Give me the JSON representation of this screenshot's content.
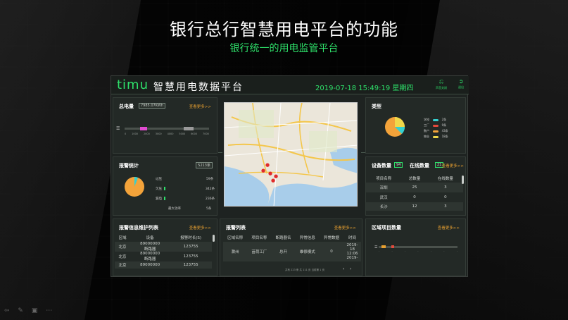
{
  "slide": {
    "headline": "银行总行智慧用电平台的功能",
    "subline": "银行统一的用电监管平台"
  },
  "topbar": {
    "logo": "timu",
    "title": "智慧用电数据平台",
    "datetime": "2019-07-18 15:49:19 星期四",
    "icon1_label": "声音关闭",
    "icon2_label": "退出"
  },
  "total_power": {
    "title": "总电量",
    "value": "7985.07KWh",
    "more": "查看更多>>",
    "axis_labels": [
      "0",
      "1000",
      "2000",
      "3000",
      "4000",
      "5000",
      "6000",
      "7000"
    ]
  },
  "alarm_stats": {
    "title": "报警统计",
    "count": "5213条",
    "items": [
      {
        "label": "过压",
        "value": "59条"
      },
      {
        "label": "欠压",
        "value": "342条"
      },
      {
        "label": "漏电",
        "value": "236条"
      },
      {
        "label": "最大功率",
        "value": "5条"
      }
    ]
  },
  "types": {
    "title": "类型",
    "legend": [
      {
        "label": "学校",
        "value": "2条",
        "color": "#35d0d0"
      },
      {
        "label": "工厂",
        "value": "9条",
        "color": "#e34a3c"
      },
      {
        "label": "数户",
        "value": "43条",
        "color": "#f3a33a"
      },
      {
        "label": "物业",
        "value": "18条",
        "color": "#f0d84a"
      }
    ]
  },
  "devices": {
    "title": "设备数量",
    "count": "94",
    "online_title": "在线数量",
    "online_count": "21",
    "more": "查看更多>>",
    "headers": [
      "项目名称",
      "总数量",
      "在线数量"
    ],
    "rows": [
      [
        "深圳",
        "25",
        "3"
      ],
      [
        "武汉",
        "0",
        "0"
      ],
      [
        "长沙",
        "12",
        "3"
      ]
    ]
  },
  "maintenance": {
    "title": "报警信息维护列表",
    "more": "查看更多>>",
    "headers": [
      "区域",
      "设备",
      "报警时长(S)"
    ],
    "rows": [
      [
        "北京",
        "89000000",
        "断路器",
        "123755"
      ],
      [
        "北京",
        "89000000",
        "断路器",
        "123755"
      ],
      [
        "北京",
        "89000000",
        "断路器",
        "123755"
      ]
    ]
  },
  "alarm_list": {
    "title": "报警列表",
    "more": "查看更多>>",
    "headers": [
      "区域名称",
      "项目名称",
      "断路器名",
      "异常信息",
      "异常数据",
      "时间"
    ],
    "row": [
      "滁州",
      "苗荷工厂",
      "总开",
      "维修模式",
      "0",
      "2019-",
      "18",
      "12:06",
      "2019-"
    ],
    "pager": "共有 223 条 共 111 页 当前第 1 页"
  },
  "region_projects": {
    "title": "区域项目数量",
    "more": "查看更多>>"
  }
}
